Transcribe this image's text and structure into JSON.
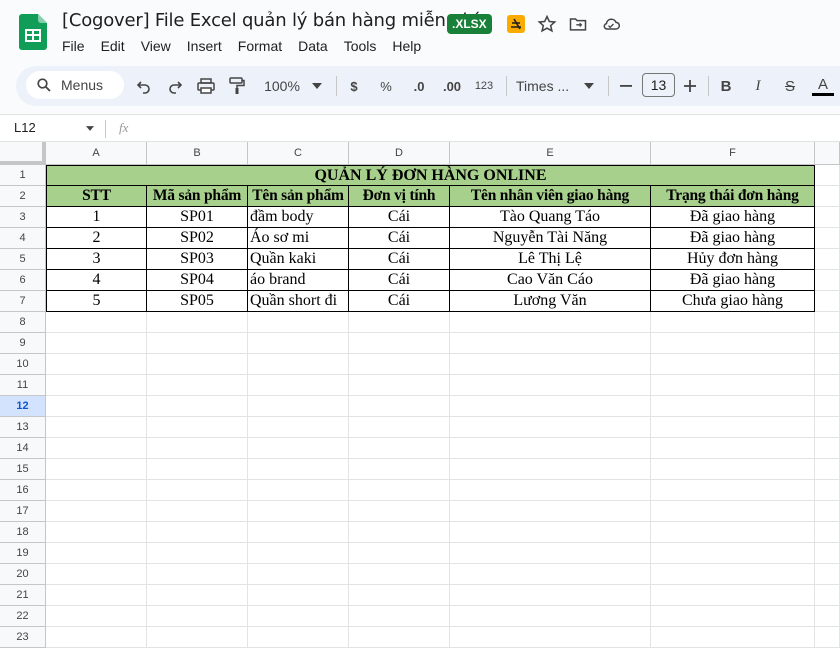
{
  "app": {
    "title": "[Cogover] File Excel quản lý bán hàng miễn phí",
    "badge": ".XLSX",
    "icons": [
      "sheets-logo",
      "offline-icon",
      "star-icon",
      "move-folder-icon",
      "cloud-status-icon"
    ],
    "colors": {
      "brand_green": "#188038",
      "header_fill": "#a8d08d",
      "selected_row": "#d3e3fd"
    }
  },
  "menu": [
    "File",
    "Edit",
    "View",
    "Insert",
    "Format",
    "Data",
    "Tools",
    "Help"
  ],
  "toolbar": {
    "search_label": "Menus",
    "zoom": "100%",
    "currency": "$",
    "percent": "%",
    "decrease_decimal": ".0",
    "increase_decimal": ".00",
    "number_format": "123",
    "font_name": "Times ...",
    "font_size": "13",
    "bold": "B",
    "italic": "I",
    "strike": "S",
    "text_color": "A"
  },
  "formula_bar": {
    "cell_ref": "L12",
    "fx": "fx",
    "value": ""
  },
  "sheet": {
    "columns": [
      "A",
      "B",
      "C",
      "D",
      "E",
      "F"
    ],
    "rows": [
      "1",
      "2",
      "3",
      "4",
      "5",
      "6",
      "7",
      "8",
      "9",
      "10",
      "11",
      "12",
      "13",
      "14",
      "15",
      "16",
      "17",
      "18",
      "19",
      "20",
      "21",
      "22",
      "23"
    ],
    "selected_row": "12",
    "title": "QUẢN LÝ ĐƠN HÀNG ONLINE",
    "headers": [
      "STT",
      "Mã sản phẩm",
      "Tên sản phẩm",
      "Đơn vị tính",
      "Tên nhân viên giao hàng",
      "Trạng thái đơn hàng"
    ],
    "data": [
      [
        "1",
        "SP01",
        "đầm body",
        "Cái",
        "Tào Quang Táo",
        "Đã giao hàng"
      ],
      [
        "2",
        "SP02",
        "Áo sơ mi",
        "Cái",
        "Nguyễn Tài Năng",
        "Đã giao hàng"
      ],
      [
        "3",
        "SP03",
        "Quần kaki",
        "Cái",
        "Lê Thị Lệ",
        "Hủy đơn hàng"
      ],
      [
        "4",
        "SP04",
        "áo brand",
        "Cái",
        "Cao Văn Cáo",
        "Đã giao hàng"
      ],
      [
        "5",
        "SP05",
        "Quần short đi",
        "Cái",
        "Lương Văn",
        "Chưa giao hàng"
      ]
    ]
  }
}
